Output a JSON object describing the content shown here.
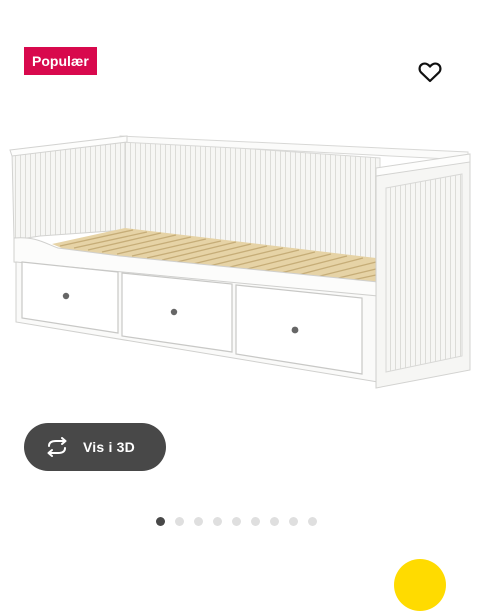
{
  "badge": {
    "label": "Populær",
    "color": "#d8094d"
  },
  "favorite": {
    "icon": "heart-outline-icon"
  },
  "product_image": {
    "subject": "white daybed with three drawers"
  },
  "view3d": {
    "label": "Vis i 3D",
    "icon": "rotate-3d-icon"
  },
  "carousel": {
    "count": 9,
    "active_index": 0
  },
  "colors": {
    "pill_bg": "#484848",
    "accent_yellow": "#ffdb00"
  }
}
